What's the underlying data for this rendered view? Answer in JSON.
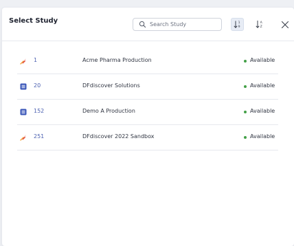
{
  "dialog": {
    "title": "Select Study",
    "search": {
      "placeholder": "Search Study",
      "value": ""
    },
    "sort_numeric_icon": "sort-numeric-icon",
    "sort_alpha_icon": "sort-alpha-icon",
    "close_icon": "close-icon"
  },
  "studies": [
    {
      "id": "1",
      "name": "Acme Pharma Production",
      "status": "Available",
      "icon": "sandbox-icon"
    },
    {
      "id": "20",
      "name": "DFdiscover Solutions",
      "status": "Available",
      "icon": "production-icon"
    },
    {
      "id": "152",
      "name": "Demo A Production",
      "status": "Available",
      "icon": "production-icon"
    },
    {
      "id": "251",
      "name": "DFdiscover 2022 Sandbox",
      "status": "Available",
      "icon": "sandbox-icon"
    }
  ],
  "colors": {
    "accent": "#4a5fb0",
    "production_icon": "#3b57b8",
    "sandbox_icon_primary": "#e0483a",
    "sandbox_icon_secondary": "#f2a33a",
    "available_dot": "#43a047"
  }
}
